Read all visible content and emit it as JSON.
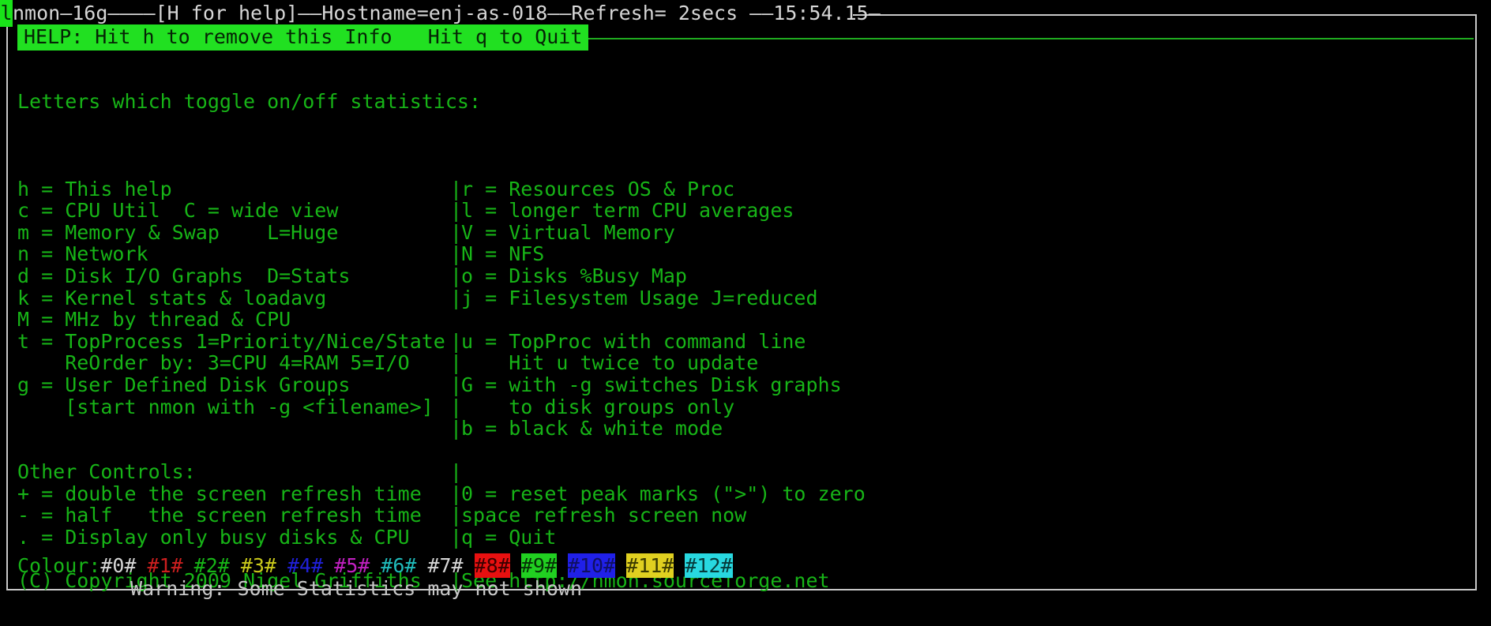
{
  "header": {
    "cursor_char": "l",
    "title_line": "nmon—16g————[H for help]——Hostname=enj-as-018——Refresh= 2secs ——15:54.15—"
  },
  "help_banner": {
    "text": "HELP: Hit h to remove this Info   Hit q to Quit",
    "bg": "#21e021",
    "fg": "#052305"
  },
  "body": {
    "intro": "Letters which toggle on/off statistics:",
    "rows": [
      {
        "left": "h = This help",
        "sep": "|",
        "right": "r = Resources OS & Proc"
      },
      {
        "left": "c = CPU Util  C = wide view",
        "sep": "|",
        "right": "l = longer term CPU averages"
      },
      {
        "left": "m = Memory & Swap    L=Huge",
        "sep": "|",
        "right": "V = Virtual Memory"
      },
      {
        "left": "n = Network",
        "sep": "|",
        "right": "N = NFS"
      },
      {
        "left": "d = Disk I/O Graphs  D=Stats",
        "sep": "|",
        "right": "o = Disks %Busy Map"
      },
      {
        "left": "k = Kernel stats & loadavg",
        "sep": "|",
        "right": "j = Filesystem Usage J=reduced"
      },
      {
        "left": "M = MHz by thread & CPU",
        "sep": "",
        "right": ""
      },
      {
        "left": "t = TopProcess 1=Priority/Nice/State",
        "sep": "|",
        "right": "u = TopProc with command line"
      },
      {
        "left": "    ReOrder by: 3=CPU 4=RAM 5=I/O",
        "sep": "|",
        "right": "    Hit u twice to update"
      },
      {
        "left": "g = User Defined Disk Groups",
        "sep": "|",
        "right": "G = with -g switches Disk graphs"
      },
      {
        "left": "    [start nmon with -g <filename>]",
        "sep": "|",
        "right": "    to disk groups only"
      },
      {
        "left": "",
        "sep": "|",
        "right": "b = black & white mode"
      },
      {
        "left": "",
        "sep": "",
        "right": ""
      },
      {
        "left": "Other Controls:",
        "sep": "|",
        "right": ""
      },
      {
        "left": "+ = double the screen refresh time",
        "sep": "|",
        "right": "0 = reset peak marks (\">\") to zero"
      },
      {
        "left": "- = half   the screen refresh time",
        "sep": "|",
        "right": "space refresh screen now"
      },
      {
        "left": ". = Display only busy disks & CPU",
        "sep": "|",
        "right": "q = Quit"
      },
      {
        "left": "",
        "sep": "",
        "right": ""
      },
      {
        "left": "(C) Copyright 2009 Nigel Griffiths",
        "sep": "|",
        "right": "See http://nmon.sourceforge.net"
      }
    ]
  },
  "colour_legend": {
    "label": "Colour:",
    "swatches": [
      {
        "text": "#0#",
        "fg": "#d6d6d6",
        "bg": "transparent"
      },
      {
        "text": "#1#",
        "fg": "#cc1f1f",
        "bg": "transparent"
      },
      {
        "text": "#2#",
        "fg": "#17b417",
        "bg": "transparent"
      },
      {
        "text": "#3#",
        "fg": "#c9c91b",
        "bg": "transparent"
      },
      {
        "text": "#4#",
        "fg": "#2020d8",
        "bg": "transparent"
      },
      {
        "text": "#5#",
        "fg": "#c020c0",
        "bg": "transparent"
      },
      {
        "text": "#6#",
        "fg": "#20bcbc",
        "bg": "transparent"
      },
      {
        "text": "#7#",
        "fg": "#d6d6d6",
        "bg": "transparent"
      },
      {
        "text": "#8#",
        "fg": "#3a0000",
        "bg": "#e81010"
      },
      {
        "text": "#9#",
        "fg": "#063006",
        "bg": "#21d021"
      },
      {
        "text": "#10#",
        "fg": "#101060",
        "bg": "#2020e8"
      },
      {
        "text": "#11#",
        "fg": "#3a3a00",
        "bg": "#e0d020"
      },
      {
        "text": "#12#",
        "fg": "#063a3a",
        "bg": "#28d8e0"
      }
    ]
  },
  "footer": {
    "warning": "—Warning: Some Statistics may not shown—"
  }
}
